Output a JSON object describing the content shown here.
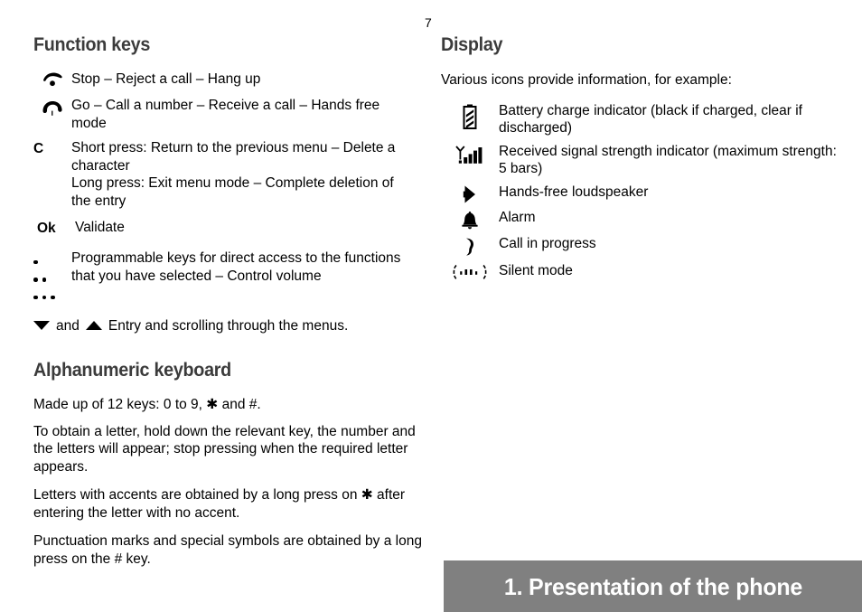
{
  "page": {
    "number": "7"
  },
  "left_column": {
    "function_keys": {
      "title": "Function keys",
      "rows": [
        {
          "key_type": "icon",
          "key_icon": "phone-hangup-icon",
          "key_label": "",
          "text": "Stop – Reject a call – Hang up"
        },
        {
          "key_type": "icon",
          "key_icon": "phone-pickup-icon",
          "key_label": "",
          "text": "Go – Call a number – Receive a call – Hands free mode"
        },
        {
          "key_type": "letter",
          "key_icon": "c-key-icon",
          "key_label": "C",
          "text": "Short press: Return to the previous menu – Delete a character\nLong press: Exit menu mode – Complete deletion of the entry"
        },
        {
          "key_type": "letter",
          "key_icon": "ok-key-icon",
          "key_label": "Ok",
          "text": "Validate"
        }
      ],
      "programmable": {
        "key_icon": "programmable-dots-icon",
        "dot_counts": [
          1,
          2,
          3
        ],
        "text": "Programmable keys for direct access to the functions that you have selected – Control volume"
      },
      "scroll_row": {
        "down_icon": "arrow-down-icon",
        "and_label": "and",
        "up_icon": "arrow-up-icon",
        "text": "Entry and scrolling through the menus."
      }
    },
    "alphanumeric_keyboard": {
      "title": "Alphanumeric keyboard",
      "paragraphs": [
        "Made up of 12 keys: 0 to 9, ✱ and #.",
        "To obtain a letter, hold down the relevant key, the number and the letters will appear; stop pressing when the required letter appears.",
        "Letters with accents are obtained by a long press on ✱ after entering the letter with no accent.",
        "Punctuation marks and special symbols are obtained by a long press on the # key."
      ]
    }
  },
  "right_column": {
    "display": {
      "title": "Display",
      "intro": "Various icons provide information, for example:",
      "icons": [
        {
          "icon": "battery-charge-icon",
          "text": "Battery charge indicator (black if charged, clear if discharged)"
        },
        {
          "icon": "signal-strength-icon",
          "text": "Received signal strength indicator (maximum strength: 5 bars)"
        },
        {
          "icon": "hands-free-loudspeaker-icon",
          "text": "Hands-free loudspeaker"
        },
        {
          "icon": "alarm-bell-icon",
          "text": "Alarm"
        },
        {
          "icon": "call-in-progress-icon",
          "text": "Call in progress"
        },
        {
          "icon": "silent-mode-icon",
          "text": "Silent mode"
        }
      ]
    }
  },
  "footer": {
    "chapter_title": "1. Presentation of the phone",
    "background_color": "#808080",
    "text_color": "#ffffff"
  },
  "colors": {
    "heading": "#3b3b3b",
    "body": "#000000",
    "page_background": "#ffffff"
  }
}
